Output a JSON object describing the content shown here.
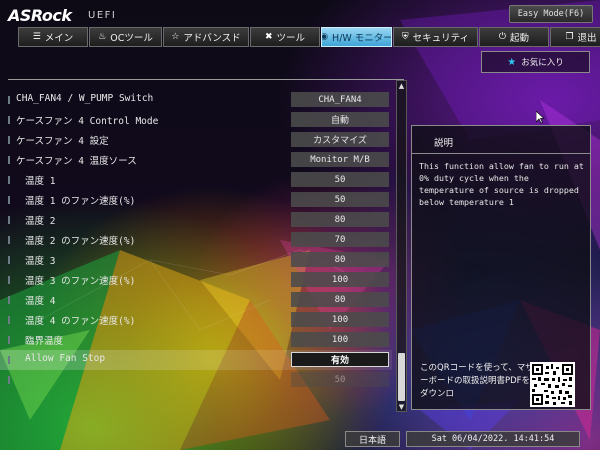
{
  "header": {
    "brand": "ASRock",
    "brand_sub": "UEFI",
    "easy_mode": "Easy Mode(F6)"
  },
  "tabs": [
    {
      "label": "メイン",
      "icon": "list-icon",
      "glyph": "☰",
      "active": false
    },
    {
      "label": "OCツール",
      "icon": "flame-icon",
      "glyph": "♨",
      "active": false
    },
    {
      "label": "アドバンスド",
      "icon": "star-icon",
      "glyph": "☆",
      "active": false
    },
    {
      "label": "ツール",
      "icon": "tools-icon",
      "glyph": "✖",
      "active": false
    },
    {
      "label": "H/W モニター",
      "icon": "monitor-icon",
      "glyph": "◉",
      "active": true
    },
    {
      "label": "セキュリティ",
      "icon": "shield-icon",
      "glyph": "⛨",
      "active": false
    },
    {
      "label": "起動",
      "icon": "power-icon",
      "glyph": "⏻",
      "active": false
    },
    {
      "label": "退出",
      "icon": "exit-icon",
      "glyph": "❐",
      "active": false
    }
  ],
  "favorites_label": "お気に入り",
  "settings": [
    {
      "label": "CHA_FAN4 / W_PUMP Switch",
      "value": "CHA_FAN4",
      "indent": false,
      "state": "normal"
    },
    {
      "label": "ケースファン 4 Control Mode",
      "value": "自動",
      "indent": false,
      "state": "normal"
    },
    {
      "label": "ケースファン 4 設定",
      "value": "カスタマイズ",
      "indent": false,
      "state": "normal"
    },
    {
      "label": "ケースファン 4 温度ソース",
      "value": "Monitor M/B",
      "indent": false,
      "state": "normal"
    },
    {
      "label": "温度 1",
      "value": "50",
      "indent": true,
      "state": "normal"
    },
    {
      "label": "温度 1 のファン速度(%)",
      "value": "50",
      "indent": true,
      "state": "normal"
    },
    {
      "label": "温度 2",
      "value": "80",
      "indent": true,
      "state": "normal"
    },
    {
      "label": "温度 2 のファン速度(%)",
      "value": "70",
      "indent": true,
      "state": "normal"
    },
    {
      "label": "温度 3",
      "value": "80",
      "indent": true,
      "state": "normal"
    },
    {
      "label": "温度 3 のファン速度(%)",
      "value": "100",
      "indent": true,
      "state": "normal"
    },
    {
      "label": "温度 4",
      "value": "80",
      "indent": true,
      "state": "normal"
    },
    {
      "label": "温度 4 のファン速度(%)",
      "value": "100",
      "indent": true,
      "state": "normal"
    },
    {
      "label": "臨界温度",
      "value": "100",
      "indent": true,
      "state": "normal"
    },
    {
      "label": "Allow Fan Stop",
      "value": "有効",
      "indent": true,
      "state": "selected"
    },
    {
      "label": "",
      "value": "50",
      "indent": true,
      "state": "dim"
    }
  ],
  "description": {
    "title": "説明",
    "body": "This function allow fan to run at 0% duty cycle when the temperature of source is dropped below temperature 1",
    "qr_text": "このQRコードを使って、マザーボードの取扱説明書PDFをダウンロ"
  },
  "footer": {
    "language": "日本語",
    "datetime": "Sat 06/04/2022. 14:41:54"
  },
  "colors": {
    "active_tab": "#3ea4d8",
    "accent_star": "#2ec4f2"
  }
}
